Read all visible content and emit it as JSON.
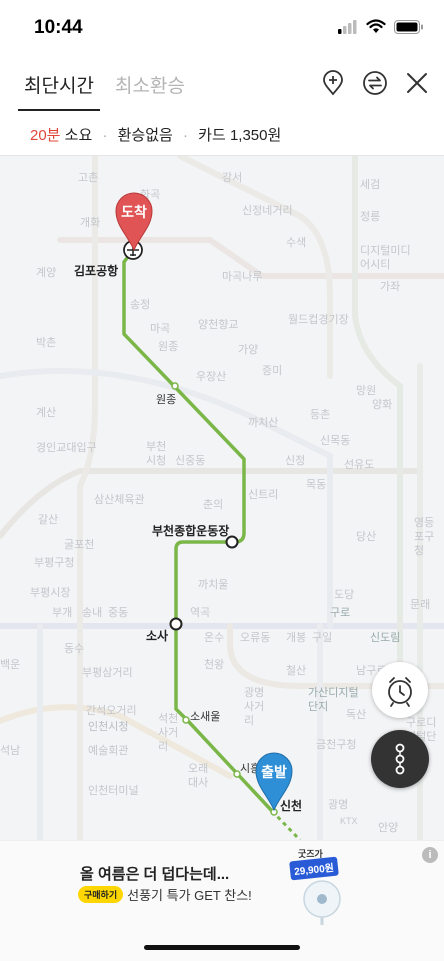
{
  "status_bar": {
    "time": "10:44"
  },
  "tabs": [
    {
      "label": "최단시간",
      "active": true
    },
    {
      "label": "최소환승",
      "active": false
    }
  ],
  "icons": {
    "add_stop": "add-stop-icon",
    "swap": "swap-icon",
    "close": "close-icon"
  },
  "summary": {
    "duration_value": "20분",
    "duration_suffix": " 소요",
    "transfer": "환승없음",
    "fare": "카드 1,350원",
    "separator": "·"
  },
  "map": {
    "background_labels": [
      "고촌",
      "개화",
      "화곡",
      "강서",
      "신정네거리",
      "세검",
      "정릉",
      "수색",
      "디지털미디어시티",
      "가좌",
      "계양",
      "마곡나루",
      "송정",
      "마곡",
      "양천향교",
      "월드컵경기장",
      "박촌",
      "가양",
      "증미",
      "망원",
      "원종",
      "우장산",
      "까치산",
      "등촌",
      "양화",
      "계산",
      "경인교대입구",
      "신목동",
      "선유도",
      "부천시청",
      "신중동",
      "신정",
      "신트리",
      "목동",
      "영등포구청",
      "삼산체육관",
      "춘의",
      "당산",
      "갈산",
      "굴포천",
      "부평구청",
      "도당",
      "까치울",
      "부평시장",
      "부개",
      "송내",
      "중동",
      "역곡",
      "온수",
      "오류동",
      "개봉",
      "구일",
      "구로",
      "신도림",
      "백운",
      "동수",
      "부평삼거리",
      "천왕",
      "광명사거리",
      "철산",
      "남구로",
      "문래",
      "대림",
      "간석오거리",
      "인천시청",
      "예술회관",
      "인천터미널",
      "석천사거리",
      "오래대사",
      "석남",
      "금천구청",
      "독산",
      "가산디지털단지",
      "구로디지털단지",
      "광명",
      "안양",
      "KTX"
    ],
    "station_labels": {
      "gimpo": "김포공항",
      "wonjong": "원종",
      "bucheon_stadium": "부천종합운동장",
      "sosa": "소사",
      "sosaeul": "소새울",
      "siheung_daeya": "시흥대야",
      "sincheon": "신천"
    },
    "pins": {
      "arrival": "도착",
      "departure": "출발"
    }
  },
  "buttons": {
    "alarm": "alarm-icon",
    "route_detail": "route-detail-icon"
  },
  "ad": {
    "title": "올 여름은 더 덥다는데...",
    "badge": "구매하기",
    "subtitle": "선풍기 특가 GET 찬스!",
    "brand": "굿즈가",
    "price": "29,900원",
    "info": "i"
  },
  "colors": {
    "accent_red": "#e0453a",
    "route_green": "#7ab648",
    "pin_red": "#e05455",
    "pin_blue": "#2e8fd6"
  }
}
